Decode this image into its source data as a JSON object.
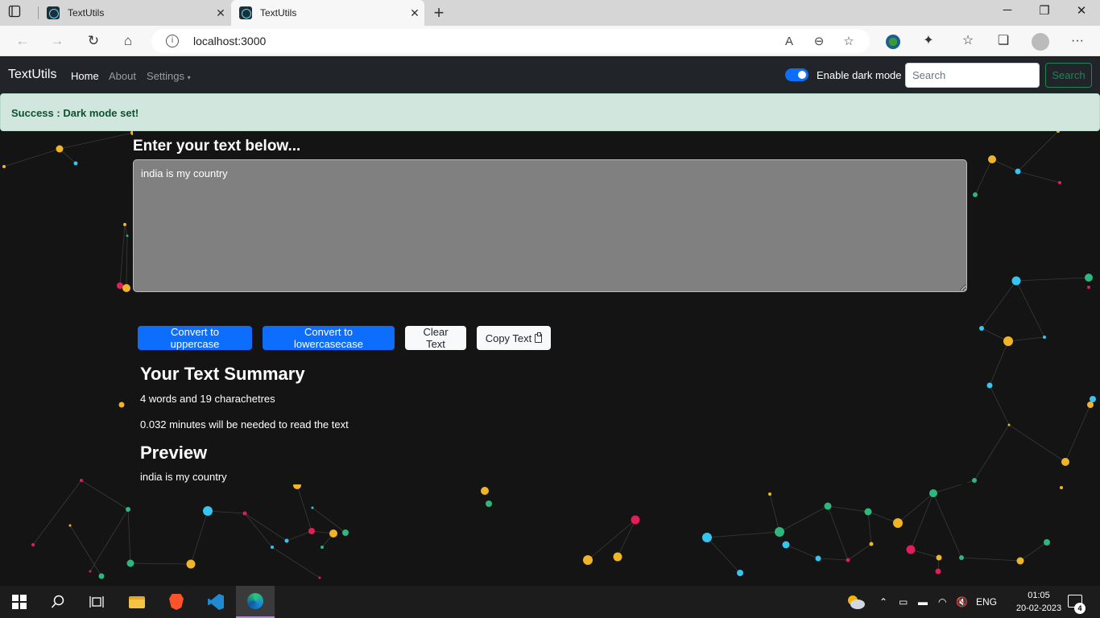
{
  "browser": {
    "tabs": [
      {
        "label": "TextUtils"
      },
      {
        "label": "TextUtils"
      }
    ],
    "url": "localhost:3000"
  },
  "navbar": {
    "brand": "TextUtils",
    "links": [
      "Home",
      "About",
      "Settings"
    ],
    "dark_mode_label": "Enable dark mode",
    "dark_mode_enabled": true,
    "search_placeholder": "Search",
    "search_button": "Search"
  },
  "alert": {
    "type": "Success",
    "message": "Dark mode set!"
  },
  "form": {
    "heading": "Enter your text below...",
    "text": "india is my country"
  },
  "buttons": {
    "uppercase": "Convert to uppercase",
    "lowercase": "Convert to lowercasecase",
    "clear": "Clear Text",
    "copy": "Copy Text"
  },
  "summary": {
    "title": "Your Text Summary",
    "counts": "4 words and 19 charachetres",
    "read_time": "0.032 minutes will be needed to read the text"
  },
  "preview": {
    "title": "Preview",
    "text": "india is my country"
  },
  "taskbar": {
    "language": "ENG",
    "time": "01:05",
    "date": "20-02-2023",
    "notifications": "4"
  },
  "colors": {
    "navbar_bg": "#212529",
    "primary": "#0d6efd",
    "alert_bg": "#d1e7dd",
    "alert_text": "#0f5132",
    "page_bg": "#141414"
  }
}
